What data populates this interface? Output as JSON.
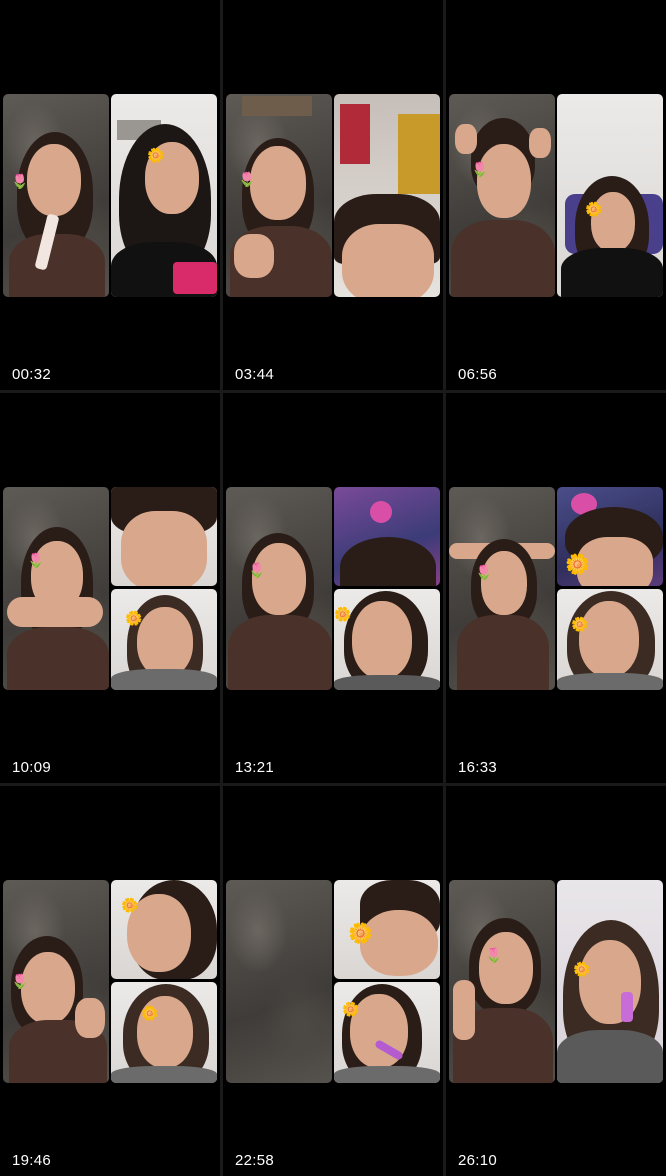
{
  "grid": {
    "items": [
      {
        "time": "00:32"
      },
      {
        "time": "03:44"
      },
      {
        "time": "06:56"
      },
      {
        "time": "10:09"
      },
      {
        "time": "13:21"
      },
      {
        "time": "16:33"
      },
      {
        "time": "19:46"
      },
      {
        "time": "22:58"
      },
      {
        "time": "26:10"
      }
    ]
  },
  "colors": {
    "background": "#000000",
    "text": "#ffffff",
    "divider": "#1a1a1a"
  }
}
